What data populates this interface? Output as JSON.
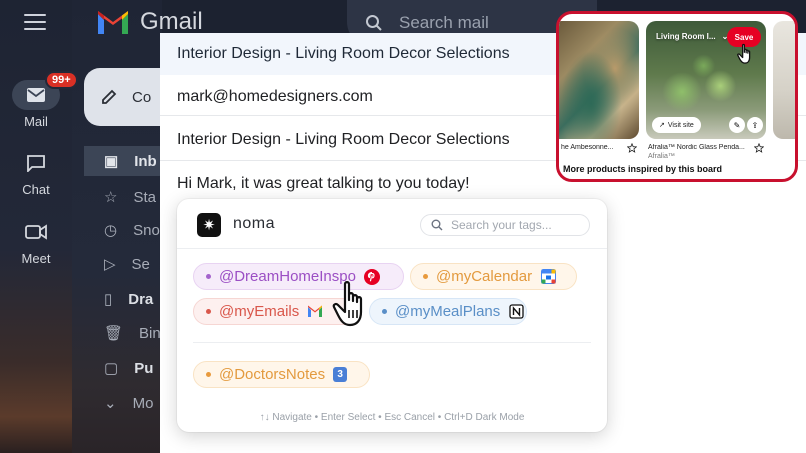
{
  "gmail": {
    "brand": "Gmail",
    "search_placeholder": "Search mail",
    "rail": [
      {
        "label": "Mail",
        "badge": "99+"
      },
      {
        "label": "Chat"
      },
      {
        "label": "Meet"
      }
    ],
    "compose_label": "Co",
    "nav": [
      {
        "label": "Inb"
      },
      {
        "label": "Sta"
      },
      {
        "label": "Sno"
      },
      {
        "label": "Se"
      },
      {
        "label": "Dra"
      },
      {
        "label": "Bin"
      },
      {
        "label": "Pu"
      },
      {
        "label": "Mo"
      }
    ]
  },
  "compose": {
    "title": "Interior Design - Living Room Decor Selections",
    "to": "mark@homedesigners.com",
    "subject": "Interior Design - Living Room Decor Selections",
    "body": "Hi Mark, it was great talking to you today!"
  },
  "noma": {
    "name": "noma",
    "search_placeholder": "Search your tags...",
    "tags": [
      {
        "label": "@DreamHomeInspo",
        "icon": "pinterest-icon"
      },
      {
        "label": "@myCalendar",
        "icon": "google-calendar-icon"
      },
      {
        "label": "@myEmails",
        "icon": "gmail-icon"
      },
      {
        "label": "@myMealPlans",
        "icon": "notion-icon"
      },
      {
        "label": "@DoctorsNotes",
        "icon": "number-3-icon",
        "icon_text": "3"
      }
    ],
    "hint": "↑↓ Navigate • Enter Select • Esc Cancel • Ctrl+D Dark Mode"
  },
  "pinterest": {
    "board_name": "Living Room I...",
    "save_label": "Save",
    "visit_label": "Visit site",
    "pins": [
      {
        "caption": "he Ambesonne..."
      },
      {
        "caption": "Afralia™ Nordic Glass Penda...",
        "subcaption": "Afralia™"
      }
    ],
    "more_label": "More products inspired by this board"
  },
  "colors": {
    "pinterest_red": "#e60023",
    "highlight_border": "#c8102e",
    "gmail_badge": "#d93025"
  }
}
